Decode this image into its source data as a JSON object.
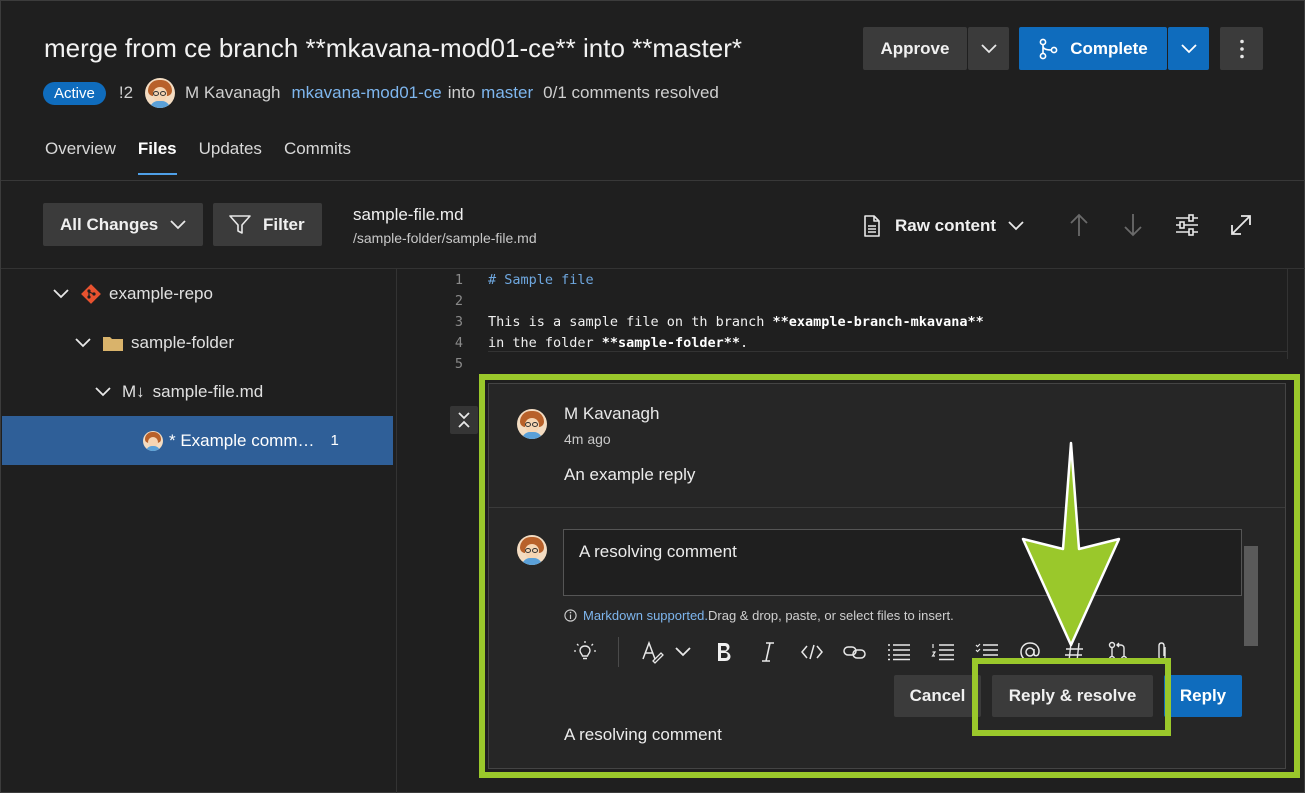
{
  "pr": {
    "title": "merge from ce branch **mkavana-mod01-ce** into **master*",
    "status": "Active",
    "id": "!2",
    "author": "M Kavanagh",
    "source_branch": "mkavana-mod01-ce",
    "into": "into",
    "target_branch": "master",
    "resolved": "0/1 comments resolved"
  },
  "actions": {
    "approve": "Approve",
    "complete": "Complete"
  },
  "tabs": [
    "Overview",
    "Files",
    "Updates",
    "Commits"
  ],
  "active_tab": "Files",
  "toolbar": {
    "all_changes": "All Changes",
    "filter": "Filter",
    "file_name": "sample-file.md",
    "file_path": "/sample-folder/sample-file.md",
    "view_mode": "Raw content"
  },
  "tree": {
    "repo": "example-repo",
    "folder": "sample-folder",
    "file_prefix": "M↓",
    "file": "sample-file.md",
    "comment": "* Example comm…",
    "comment_count": "1"
  },
  "code": {
    "lines": [
      {
        "num": "1",
        "text": "# Sample file"
      },
      {
        "num": "2",
        "text": ""
      },
      {
        "num": "3",
        "text": "This is a sample file on th branch ",
        "bold": "**example-branch-mkavana**"
      },
      {
        "num": "4",
        "text": "in the folder ",
        "bold": "**sample-folder**",
        "tail": "."
      },
      {
        "num": "5",
        "text": ""
      }
    ]
  },
  "thread": {
    "author": "M Kavanagh",
    "time": "4m ago",
    "text": "An example reply",
    "reply_value": "A resolving comment",
    "markdown_link": "Markdown supported.",
    "markdown_hint": " Drag & drop, paste, or select files to insert.",
    "cancel": "Cancel",
    "reply_resolve": "Reply & resolve",
    "reply": "Reply",
    "preview": "A resolving comment"
  },
  "colors": {
    "accent": "#0f6cbd",
    "highlight": "#9ac82b",
    "link": "#7eb6ee"
  },
  "icons": [
    "chevron-down-icon",
    "more-icon",
    "branch-merge-icon",
    "filter-icon",
    "document-icon",
    "arrow-up-icon",
    "arrow-down-icon",
    "settings-sliders-icon",
    "expand-icon",
    "git-repo-icon",
    "folder-icon",
    "collapse-icon",
    "info-icon",
    "lightbulb-icon",
    "format-text-icon",
    "bold-icon",
    "italic-icon",
    "code-icon",
    "link-icon",
    "bullet-list-icon",
    "numbered-list-icon",
    "task-list-icon",
    "mention-icon",
    "hashtag-icon",
    "pull-request-icon",
    "attach-icon"
  ]
}
